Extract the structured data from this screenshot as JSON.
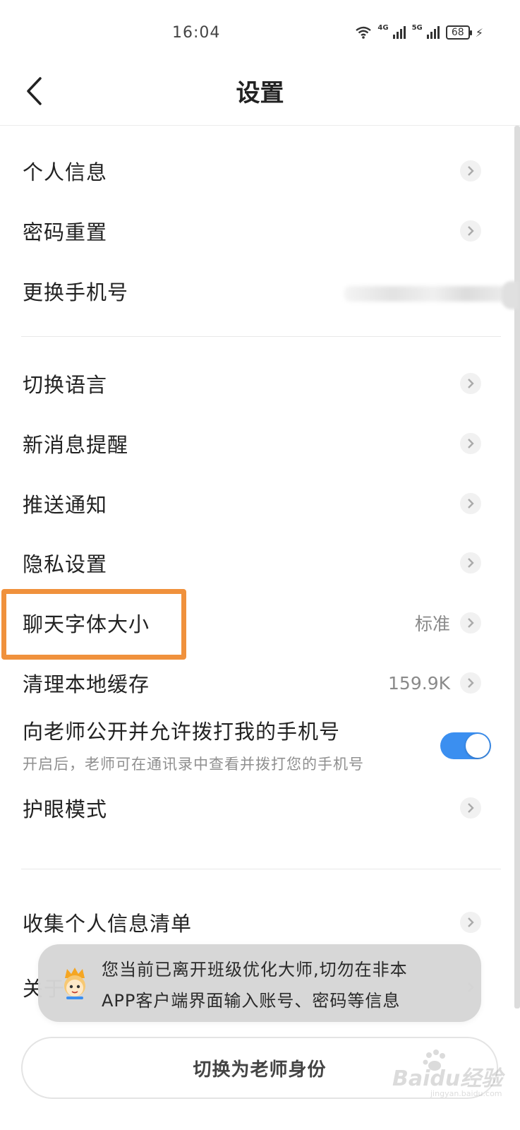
{
  "status_bar": {
    "time": "16:04",
    "net_1": "4G",
    "net_2": "5G",
    "battery": "68"
  },
  "header": {
    "title": "设置",
    "back_icon": "chevron-left-icon"
  },
  "groups": [
    {
      "items": [
        {
          "label": "个人信息",
          "value": ""
        },
        {
          "label": "密码重置",
          "value": ""
        },
        {
          "label": "更换手机号",
          "value": ""
        }
      ]
    },
    {
      "items": [
        {
          "label": "切换语言",
          "value": ""
        },
        {
          "label": "新消息提醒",
          "value": ""
        },
        {
          "label": "推送通知",
          "value": ""
        },
        {
          "label": "隐私设置",
          "value": ""
        },
        {
          "label": "聊天字体大小",
          "value": "标准"
        },
        {
          "label": "清理本地缓存",
          "value": "159.9K"
        },
        {
          "label": "向老师公开并允许拨打我的手机号",
          "subtitle": "开启后，老师可在通讯录中查看并拨打您的手机号",
          "toggle_on": true
        },
        {
          "label": "护眼模式",
          "value": ""
        }
      ]
    },
    {
      "items": [
        {
          "label": "收集个人信息清单",
          "value": ""
        },
        {
          "label": "关于",
          "value": ""
        }
      ]
    }
  ],
  "toast": {
    "line1": "您当前已离开班级优化大师,切勿在非本",
    "line2": "APP客户端界面输入账号、密码等信息"
  },
  "bottom_button": {
    "label": "切换为老师身份"
  },
  "watermark": {
    "text": "Baidu经验",
    "sub": "jingyan.baidu.com"
  },
  "colors": {
    "accent": "#3b8ff0",
    "highlight": "#f0913c"
  }
}
